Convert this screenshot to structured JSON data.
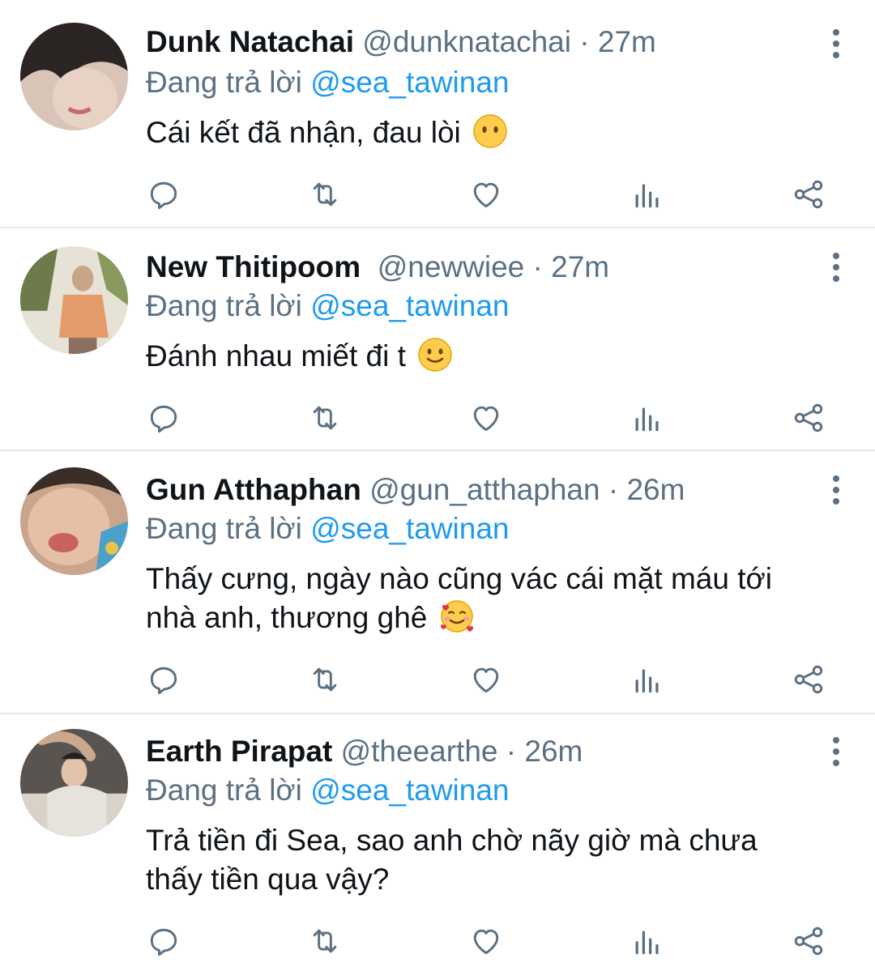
{
  "tweets": [
    {
      "name": "Dunk Natachai",
      "handle": "@dunknatachai",
      "time": "· 27m",
      "replying_prefix": "Đang trả lời",
      "replying_to": "@sea_tawinan",
      "text": "Cái kết đã nhận, đau lòi",
      "emoji": "neutral-face-emoji"
    },
    {
      "name": "New Thitipoom",
      "handle": "@newwiee",
      "time": "· 27m",
      "replying_prefix": "Đang trả lời",
      "replying_to": "@sea_tawinan",
      "text": "Đánh nhau miết đi t",
      "emoji": "slightly-smiling-face-emoji"
    },
    {
      "name": "Gun Atthaphan",
      "handle": "@gun_atthaphan",
      "time": "· 26m",
      "replying_prefix": "Đang trả lời",
      "replying_to": "@sea_tawinan",
      "text_line1": "Thấy cưng, ngày nào cũng vác cái mặt máu tới",
      "text_line2": "nhà anh, thương ghê",
      "emoji": "smiling-face-with-hearts-emoji"
    },
    {
      "name": "Earth Pirapat",
      "handle": "@theearthe",
      "time": "· 26m",
      "replying_prefix": "Đang trả lời",
      "replying_to": "@sea_tawinan",
      "text_line1": "Trả tiền đi Sea, sao anh chờ nãy giờ mà chưa",
      "text_line2": "thấy tiền qua vậy?"
    }
  ],
  "icons": [
    "reply-icon",
    "retweet-icon",
    "like-icon",
    "analytics-icon",
    "share-icon",
    "more-options-icon"
  ],
  "colors": {
    "text": "#0f1419",
    "secondary": "#5b7083",
    "mention": "#1d9bf0",
    "divider": "#e6e9ec"
  }
}
